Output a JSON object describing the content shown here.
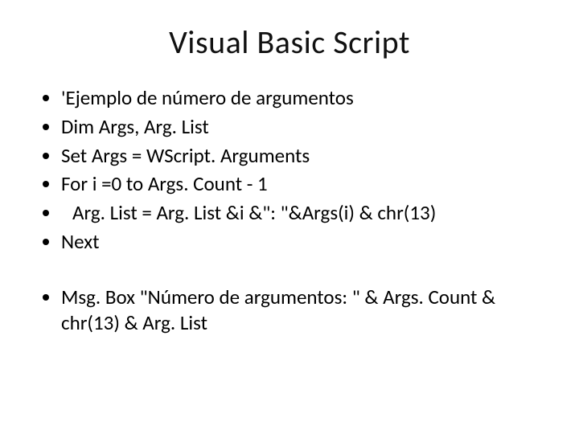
{
  "title": "Visual Basic Script",
  "lines": [
    "'Ejemplo de número de argumentos",
    "Dim Args, Arg. List",
    "Set Args = WScript. Arguments",
    "For i =0 to Args. Count - 1",
    "Arg. List = Arg. List &i &\": \"&Args(i) & chr(13)",
    "Next"
  ],
  "msg": "Msg. Box \"Número de argumentos: \" & Args. Count & chr(13) & Arg. List"
}
